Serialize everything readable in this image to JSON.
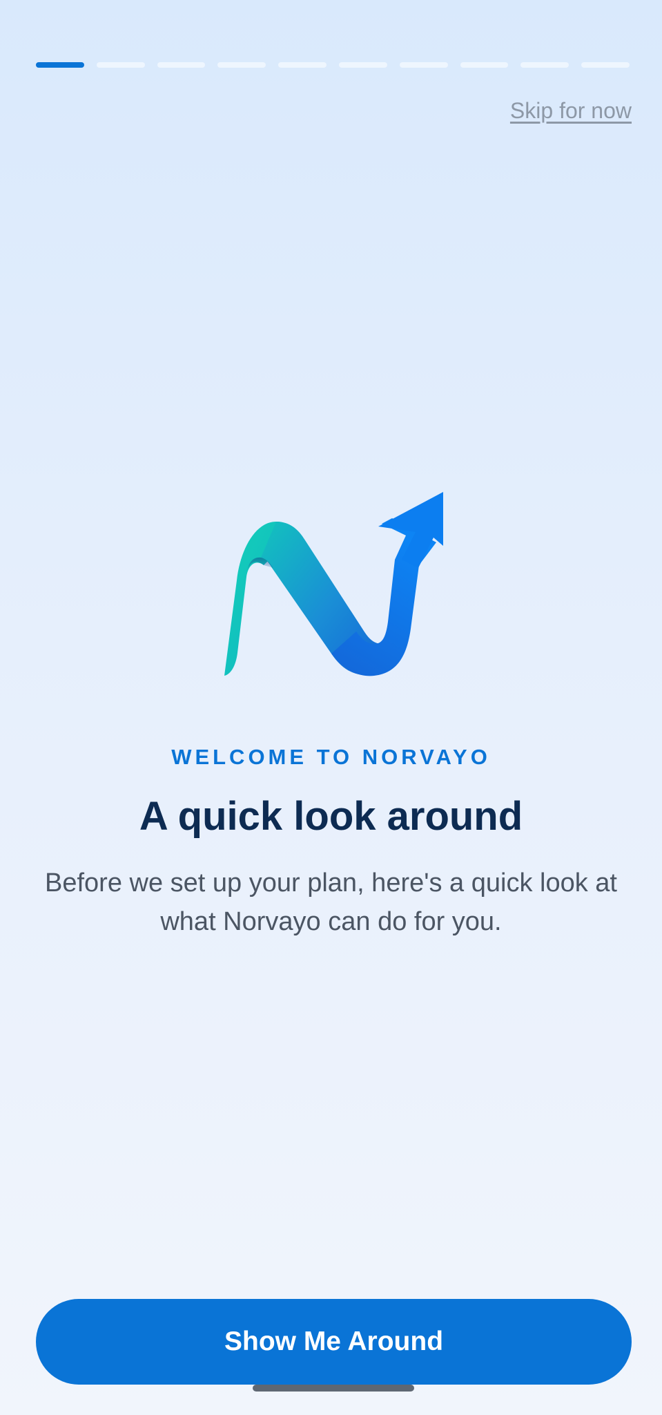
{
  "onboarding": {
    "total_steps": 10,
    "current_step": 1,
    "skip_label": "Skip for now",
    "eyebrow": "WELCOME TO NORVAYO",
    "title": "A quick look around",
    "subtitle": "Before we set up your plan, here's a quick look at what Norvayo can do for you.",
    "cta_label": "Show Me Around",
    "logo_icon": "norvayo-logo-icon"
  },
  "colors": {
    "accent": "#0a74d6",
    "title": "#0d2b52",
    "body_text": "#4b5563",
    "muted_link": "#8d98a6",
    "logo_teal": "#12c9b8",
    "logo_blue": "#0c7ef0"
  }
}
